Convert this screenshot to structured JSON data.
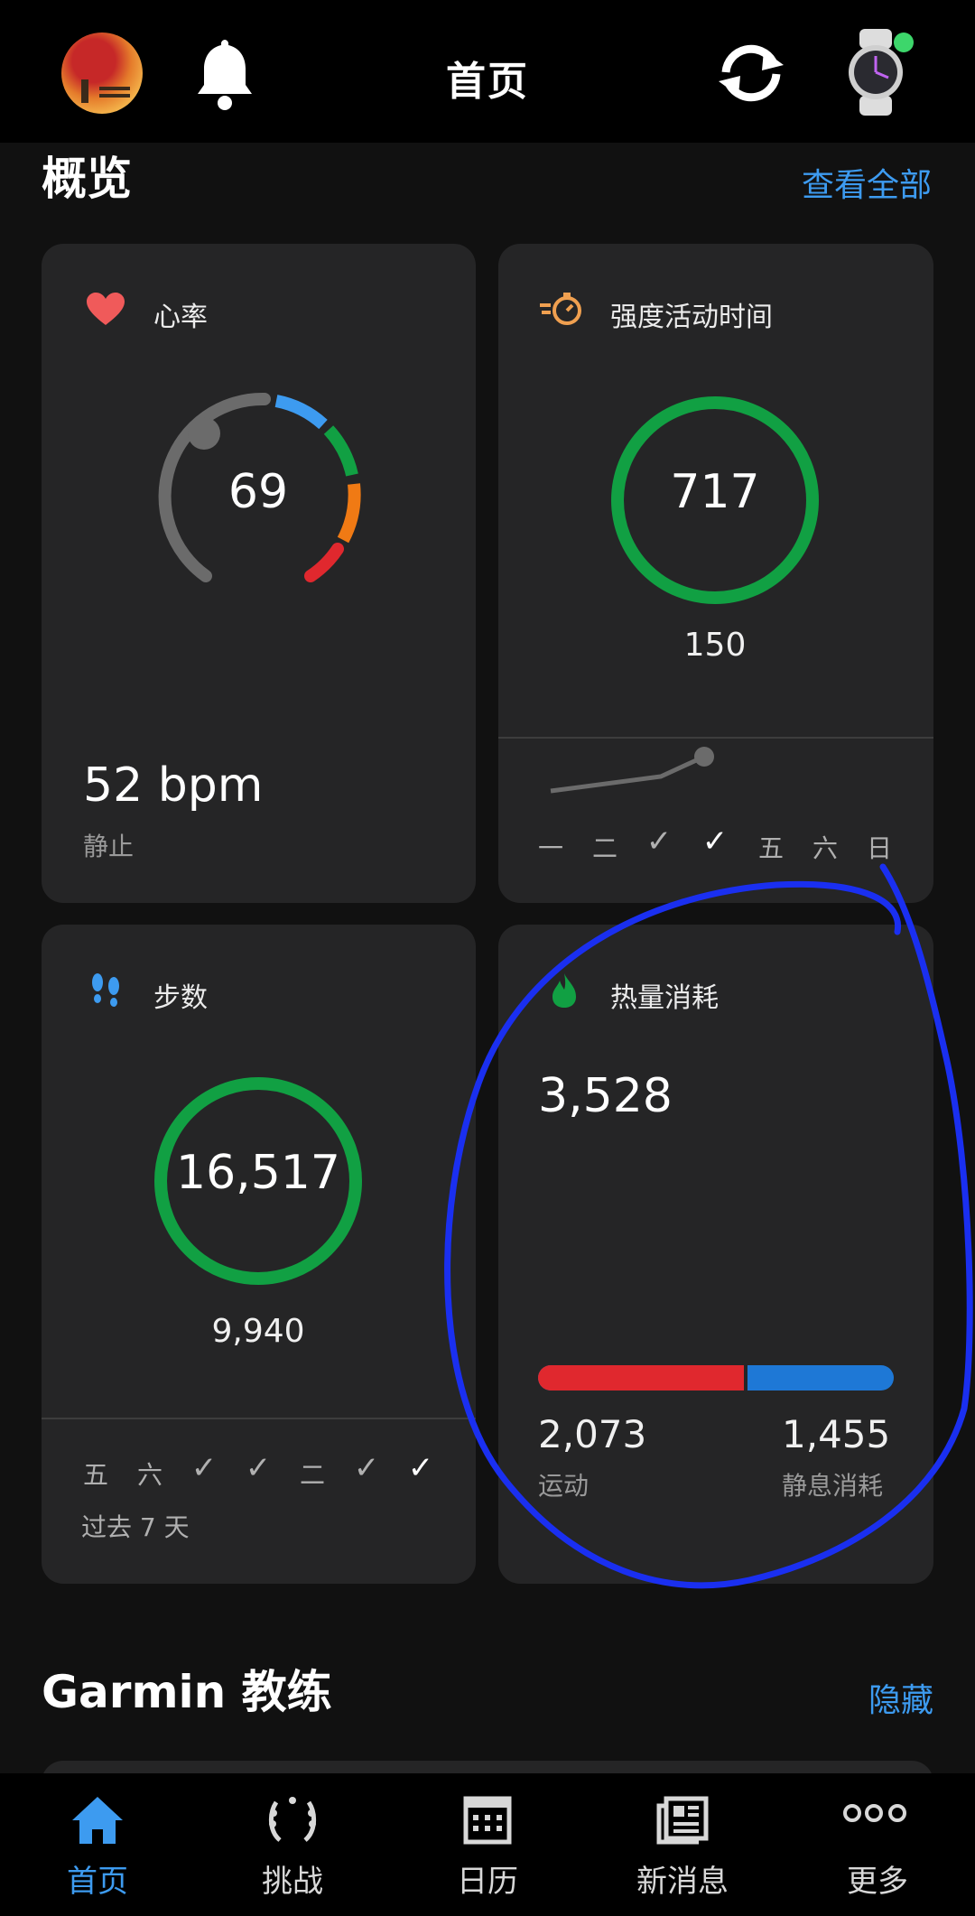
{
  "header": {
    "title": "首页",
    "avatar_icon": "avatar-icon",
    "bell_icon": "bell-icon",
    "sync_icon": "sync-icon",
    "watch_icon": "watch-icon",
    "watch_status_color": "#3dd66b"
  },
  "overview": {
    "title": "概览",
    "view_all": "查看全部"
  },
  "heart_rate": {
    "label": "心率",
    "current": "69",
    "resting_value": "52 bpm",
    "resting_label": "静止",
    "icon": "heart-icon"
  },
  "intensity": {
    "label": "强度活动时间",
    "value": "717",
    "goal": "150",
    "icon": "stopwatch-icon",
    "days": [
      "一",
      "二",
      "✓",
      "✓",
      "五",
      "六",
      "日"
    ]
  },
  "steps": {
    "label": "步数",
    "value": "16,517",
    "goal": "9,940",
    "icon": "footprints-icon",
    "days": [
      "五",
      "六",
      "✓",
      "✓",
      "二",
      "✓",
      "✓"
    ],
    "period": "过去 7 天"
  },
  "calories": {
    "label": "热量消耗",
    "total": "3,528",
    "active_value": "2,073",
    "active_label": "运动",
    "resting_value": "1,455",
    "resting_label": "静息消耗",
    "icon": "flame-icon",
    "active_fraction": 0.588,
    "active_color": "#e0282e",
    "resting_color": "#1e78d6"
  },
  "coach": {
    "title": "Garmin 教练",
    "hide": "隐藏"
  },
  "nav": [
    {
      "label": "首页",
      "icon": "home-icon"
    },
    {
      "label": "挑战",
      "icon": "laurel-icon"
    },
    {
      "label": "日历",
      "icon": "calendar-icon"
    },
    {
      "label": "新消息",
      "icon": "news-icon"
    },
    {
      "label": "更多",
      "icon": "more-icon"
    }
  ],
  "colors": {
    "accent": "#3d9bf0",
    "goal_ring": "#11a043",
    "annotation": "#1a2ff0"
  }
}
